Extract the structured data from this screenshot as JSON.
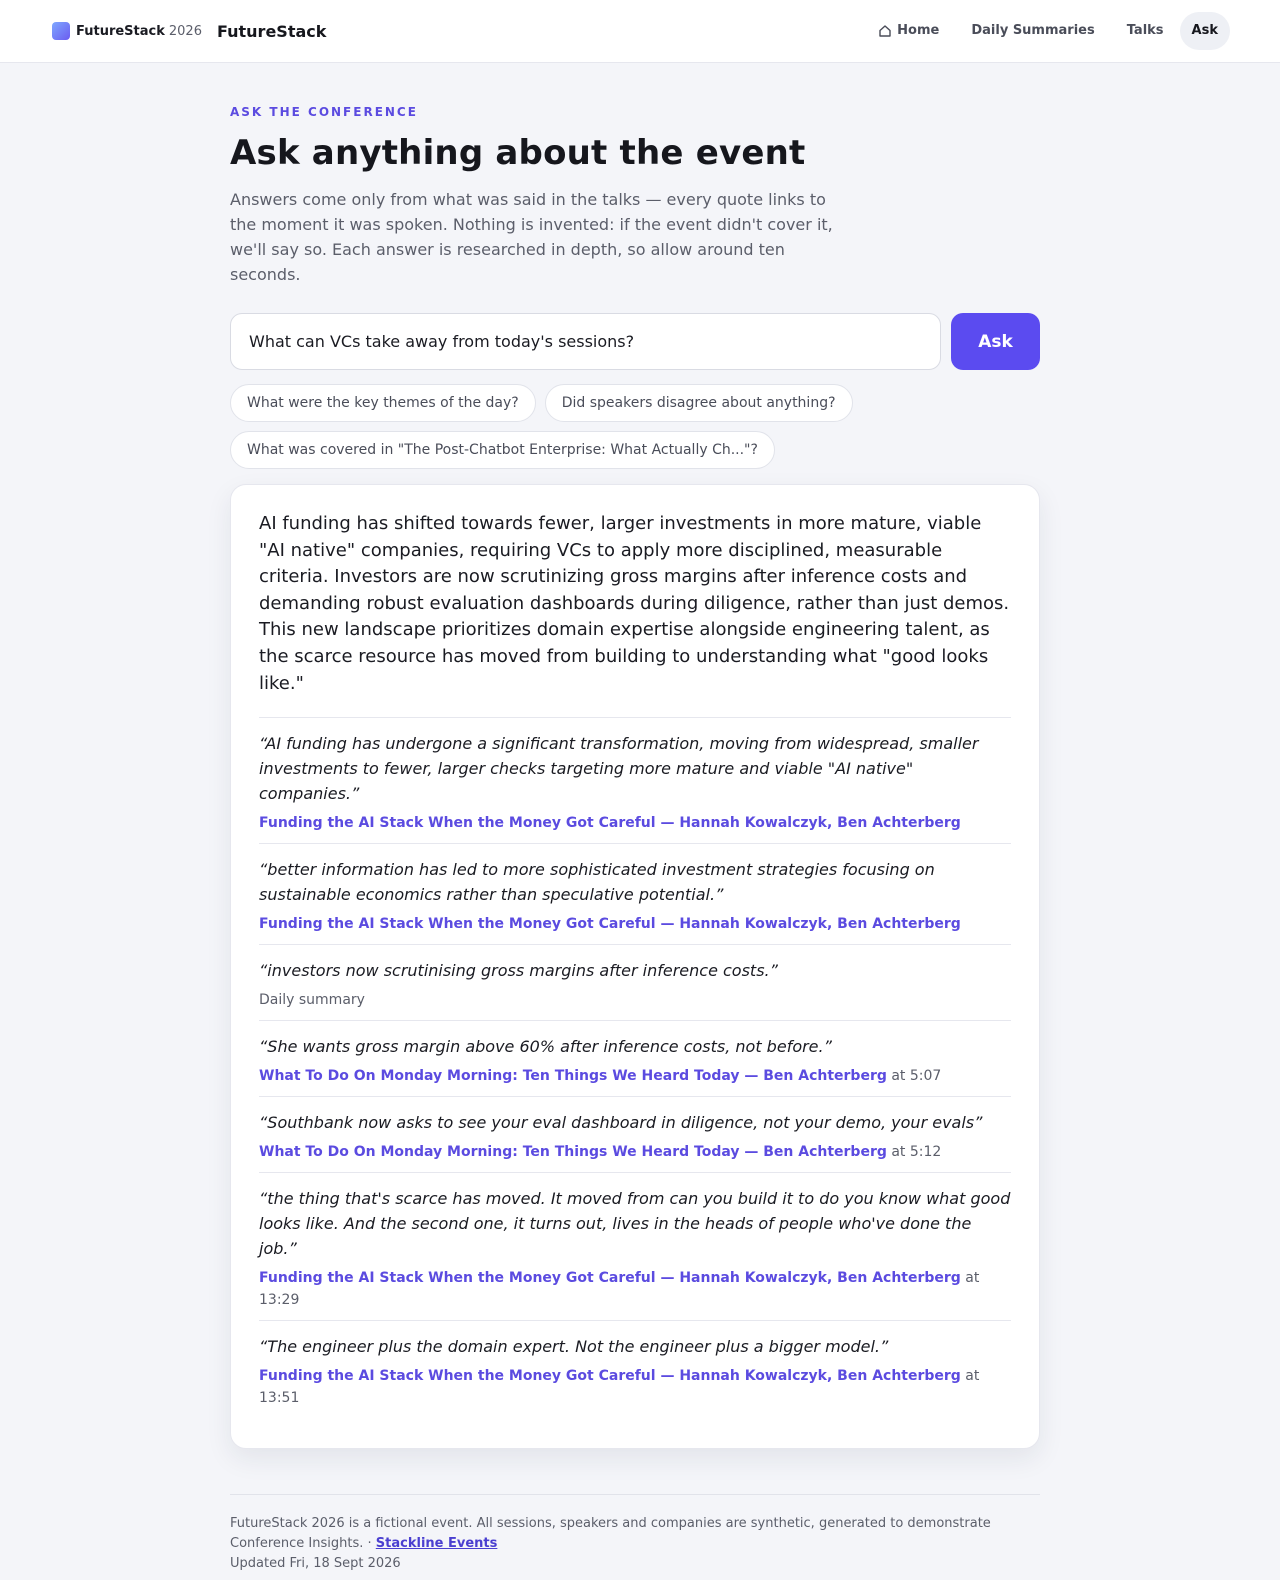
{
  "header": {
    "brand_name": "FutureStack",
    "brand_year": "2026",
    "site_title": "FutureStack",
    "nav": [
      {
        "label": "Home",
        "icon": "home-icon",
        "active": false
      },
      {
        "label": "Daily Summaries",
        "active": false
      },
      {
        "label": "Talks",
        "active": false
      },
      {
        "label": "Ask",
        "active": true
      }
    ]
  },
  "main": {
    "eyebrow": "ASK THE CONFERENCE",
    "title": "Ask anything about the event",
    "intro": "Answers come only from what was said in the talks — every quote links to the moment it was spoken. Nothing is invented: if the event didn't cover it, we'll say so. Each answer is researched in depth, so allow around ten seconds.",
    "search": {
      "value": "What can VCs take away from today's sessions?",
      "button_label": "Ask"
    },
    "suggestions": [
      "What were the key themes of the day?",
      "Did speakers disagree about anything?",
      "What was covered in \"The Post-Chatbot Enterprise: What Actually Ch...\"?"
    ]
  },
  "answer": {
    "summary": "AI funding has shifted towards fewer, larger investments in more mature, viable \"AI native\" companies, requiring VCs to apply more disciplined, measurable criteria. Investors are now scrutinizing gross margins after inference costs and demanding robust evaluation dashboards during diligence, rather than just demos. This new landscape prioritizes domain expertise alongside engineering talent, as the scarce resource has moved from building to understanding what \"good looks like.\"",
    "quotes": [
      {
        "text": "“AI funding has undergone a significant transformation, moving from widespread, smaller investments to fewer, larger checks targeting more mature and viable \"AI native\" companies.”",
        "source": "Funding the AI Stack When the Money Got Careful — Hannah Kowalczyk, Ben Achterberg",
        "time": ""
      },
      {
        "text": "“better information has led to more sophisticated investment strategies focusing on sustainable economics rather than speculative potential.”",
        "source": "Funding the AI Stack When the Money Got Careful — Hannah Kowalczyk, Ben Achterberg",
        "time": ""
      },
      {
        "text": "“investors now scrutinising gross margins after inference costs.”",
        "source": "",
        "plain_source": "Daily summary",
        "time": ""
      },
      {
        "text": "“She wants gross margin above 60% after inference costs, not before.”",
        "source": "What To Do On Monday Morning: Ten Things We Heard Today — Ben Achterberg",
        "time": " at 5:07"
      },
      {
        "text": "“Southbank now asks to see your eval dashboard in diligence, not your demo, your evals”",
        "source": "What To Do On Monday Morning: Ten Things We Heard Today — Ben Achterberg",
        "time": " at 5:12"
      },
      {
        "text": "“the thing that's scarce has moved. It moved from can you build it to do you know what good looks like. And the second one, it turns out, lives in the heads of people who've done the job.”",
        "source": "Funding the AI Stack When the Money Got Careful — Hannah Kowalczyk, Ben Achterberg",
        "time": " at 13:29"
      },
      {
        "text": "“The engineer plus the domain expert. Not the engineer plus a bigger model.”",
        "source": "Funding the AI Stack When the Money Got Careful — Hannah Kowalczyk, Ben Achterberg",
        "time": " at 13:51"
      }
    ]
  },
  "footer": {
    "text": "FutureStack 2026 is a fictional event. All sessions, speakers and companies are synthetic, generated to demonstrate Conference Insights. · ",
    "link_label": "Stackline Events",
    "updated": "Updated Fri, 18 Sept 2026"
  },
  "colors": {
    "accent": "#5b4bf0",
    "link": "#5b4be0",
    "background": "#f4f5f9"
  }
}
